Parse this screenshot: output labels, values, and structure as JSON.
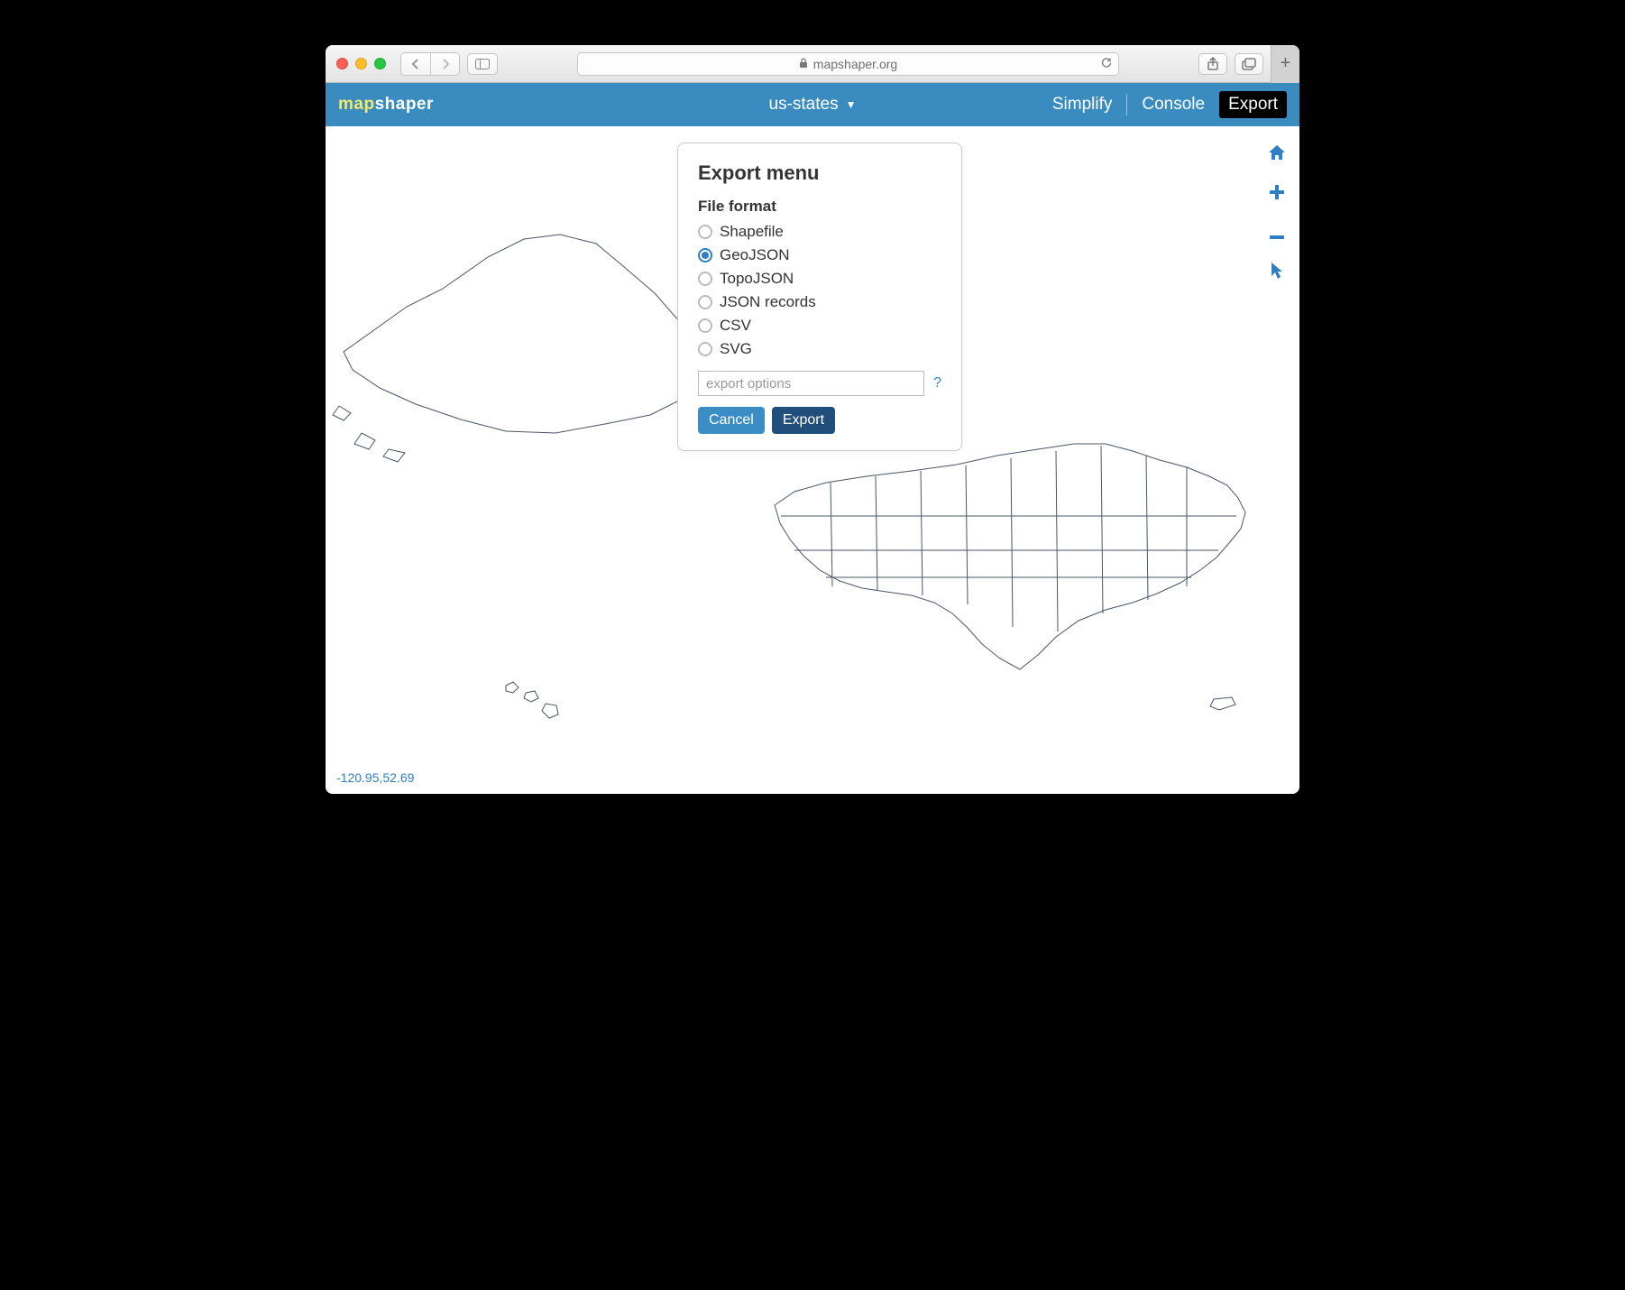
{
  "browser": {
    "url": "mapshaper.org"
  },
  "header": {
    "logo_map": "map",
    "logo_shaper": "shaper",
    "layer_name": "us-states",
    "simplify": "Simplify",
    "console": "Console",
    "export": "Export"
  },
  "export_modal": {
    "title": "Export menu",
    "section_label": "File format",
    "formats": [
      {
        "label": "Shapefile",
        "selected": false
      },
      {
        "label": "GeoJSON",
        "selected": true
      },
      {
        "label": "TopoJSON",
        "selected": false
      },
      {
        "label": "JSON records",
        "selected": false
      },
      {
        "label": "CSV",
        "selected": false
      },
      {
        "label": "SVG",
        "selected": false
      }
    ],
    "options_placeholder": "export options",
    "help": "?",
    "cancel": "Cancel",
    "export_btn": "Export"
  },
  "status": {
    "coords": "-120.95,52.69"
  },
  "tools": {
    "home": "home",
    "zoom_in": "plus",
    "zoom_out": "minus",
    "pointer": "pointer"
  }
}
